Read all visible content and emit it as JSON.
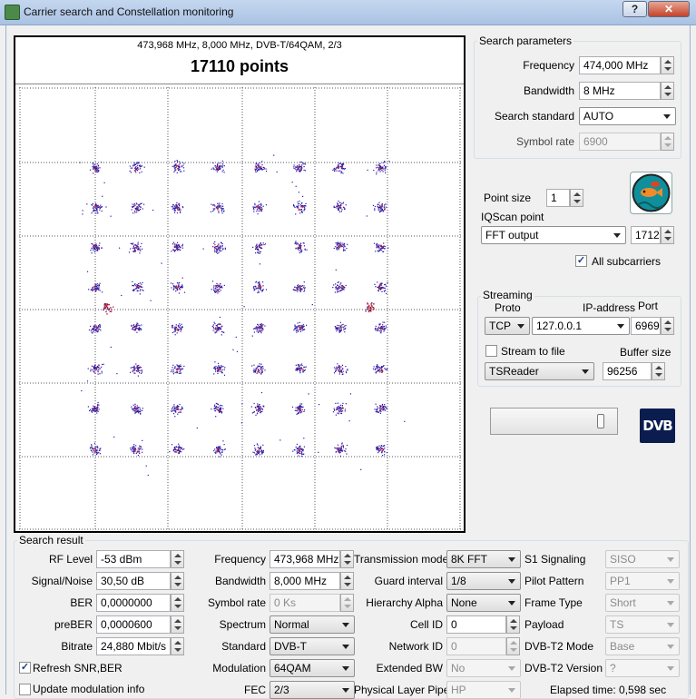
{
  "window": {
    "title": "Carrier search and Constellation monitoring",
    "help_label": "?",
    "close_label": "✕"
  },
  "constellation": {
    "info": "473,968 MHz, 8,000 MHz, DVB-T/64QAM, 2/3",
    "points": "17110 points"
  },
  "search_parameters": {
    "title": "Search parameters",
    "frequency_label": "Frequency",
    "frequency_value": "474,000 MHz",
    "bandwidth_label": "Bandwidth",
    "bandwidth_value": "8 MHz",
    "standard_label": "Search standard",
    "standard_value": "AUTO",
    "symbol_rate_label": "Symbol rate",
    "symbol_rate_value": "6900"
  },
  "display": {
    "point_size_label": "Point size",
    "point_size_value": "1",
    "iqscan_label": "IQScan point",
    "iqscan_value": "FFT output",
    "iqscan_number": "1712",
    "all_subcarriers_label": "All subcarriers",
    "all_subcarriers_mark": "✓"
  },
  "streaming": {
    "title": "Streaming",
    "proto_label": "Proto",
    "proto_value": "TCP",
    "ip_label": "IP-address",
    "ip_value": "127.0.0.1",
    "port_label": "Port",
    "port_value": "6969",
    "stream_to_file_label": "Stream to file",
    "buffer_label": "Buffer size",
    "reader_value": "TSReader",
    "buffer_value": "96256"
  },
  "dvb_logo": "DVB",
  "search_result": {
    "title": "Search result",
    "col1": [
      {
        "label": "RF Level",
        "value": "-53 dBm"
      },
      {
        "label": "Signal/Noise",
        "value": "30,50 dB"
      },
      {
        "label": "BER",
        "value": "0,0000000"
      },
      {
        "label": "preBER",
        "value": "0,0000600"
      },
      {
        "label": "Bitrate",
        "value": "24,880 Mbit/s"
      }
    ],
    "refresh_label": "Refresh SNR,BER",
    "refresh_mark": "✓",
    "update_label": "Update modulation info",
    "col2": [
      {
        "label": "Frequency",
        "value": "473,968 MHz"
      },
      {
        "label": "Bandwidth",
        "value": "8,000 MHz"
      },
      {
        "label": "Symbol rate",
        "value": "0 Ks"
      },
      {
        "label": "Spectrum",
        "value": "Normal"
      },
      {
        "label": "Standard",
        "value": "DVB-T"
      },
      {
        "label": "Modulation",
        "value": "64QAM"
      },
      {
        "label": "FEC",
        "value": "2/3"
      }
    ],
    "col3": [
      {
        "label": "Transmission mode",
        "value": "8K FFT"
      },
      {
        "label": "Guard interval",
        "value": "1/8"
      },
      {
        "label": "Hierarchy Alpha",
        "value": "None"
      },
      {
        "label": "Cell ID",
        "value": "0"
      },
      {
        "label": "Network ID",
        "value": "0"
      },
      {
        "label": "Extended BW",
        "value": "No"
      },
      {
        "label": "Physical Layer Pipe",
        "value": "HP"
      }
    ],
    "col4": [
      {
        "label": "S1 Signaling",
        "value": "SISO"
      },
      {
        "label": "Pilot Pattern",
        "value": "PP1"
      },
      {
        "label": "Frame Type",
        "value": "Short"
      },
      {
        "label": "Payload",
        "value": "TS"
      },
      {
        "label": "DVB-T2 Mode",
        "value": "Base"
      },
      {
        "label": "DVB-T2 Version",
        "value": "?"
      }
    ],
    "elapsed": "Elapsed time: 0,598 sec"
  }
}
